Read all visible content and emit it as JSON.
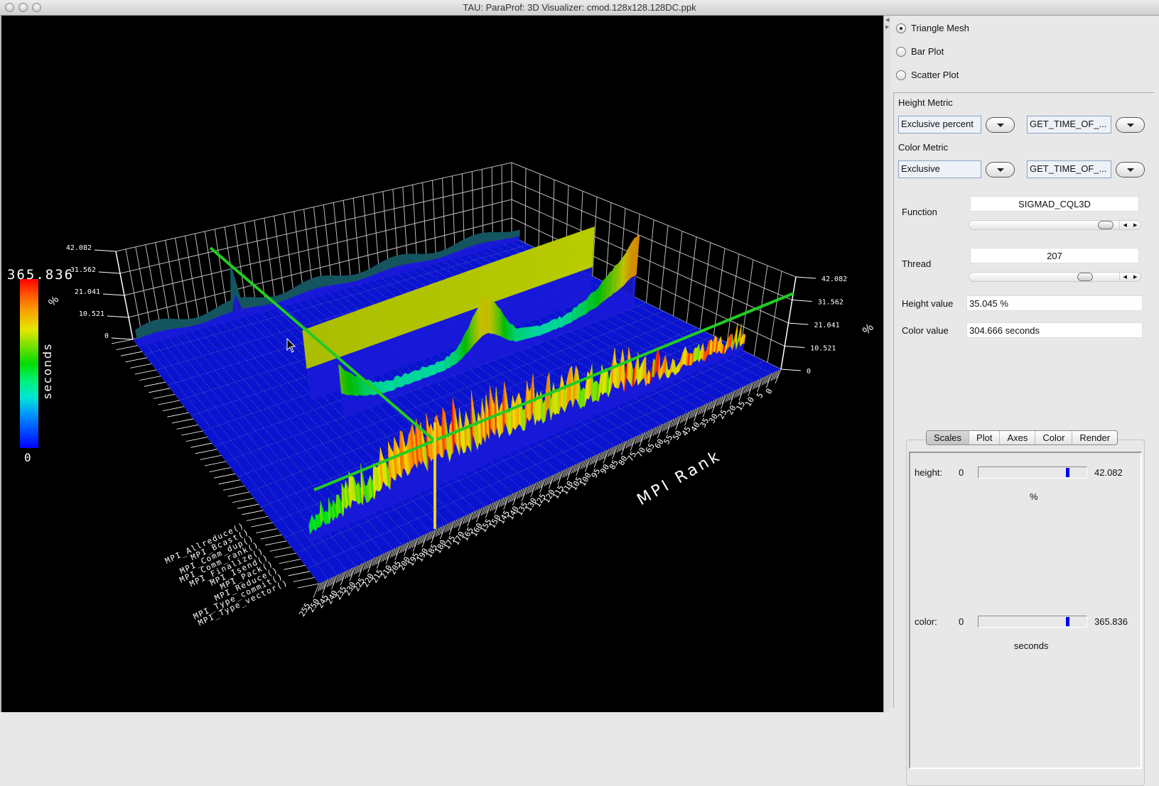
{
  "window": {
    "title": "TAU: ParaProf: 3D Visualizer: cmod.128x128.128DC.ppk"
  },
  "plot_type": {
    "options": [
      {
        "label": "Triangle Mesh",
        "selected": true
      },
      {
        "label": "Bar Plot",
        "selected": false
      },
      {
        "label": "Scatter Plot",
        "selected": false
      }
    ]
  },
  "height_metric": {
    "label": "Height Metric",
    "metric": "Exclusive percent",
    "counter": "GET_TIME_OF_..."
  },
  "color_metric": {
    "label": "Color Metric",
    "metric": "Exclusive",
    "counter": "GET_TIME_OF_..."
  },
  "function": {
    "label": "Function",
    "value": "SIGMAD_CQL3D",
    "slider_fraction": 0.95
  },
  "thread": {
    "label": "Thread",
    "value": "207",
    "slider_fraction": 0.8
  },
  "height_value": {
    "label": "Height value",
    "value": "35.045 %"
  },
  "color_value": {
    "label": "Color value",
    "value": "304.666 seconds"
  },
  "tabs": [
    {
      "label": "Scales",
      "active": true
    },
    {
      "label": "Plot",
      "active": false
    },
    {
      "label": "Axes",
      "active": false
    },
    {
      "label": "Color",
      "active": false
    },
    {
      "label": "Render",
      "active": false
    }
  ],
  "scales": {
    "height": {
      "label": "height:",
      "min": "0",
      "max": "42.082",
      "unit": "%",
      "fraction": 0.83
    },
    "color": {
      "label": "color:",
      "min": "0",
      "max": "365.836",
      "unit": "seconds",
      "fraction": 0.83
    }
  },
  "visualization": {
    "colorbar": {
      "max": "365.836",
      "min": "0",
      "unit": "seconds"
    },
    "height_axis": {
      "ticks": [
        "0",
        "10.521",
        "21.041",
        "31.562",
        "42.082"
      ],
      "unit": "%"
    },
    "rank_axis": {
      "label": "MPI Rank",
      "min": 0,
      "max": 255,
      "tick_step": 5
    },
    "function_labels": [
      "MPI_Allreduce()",
      "MPI_Bcast()",
      "MPI_Comm_dup()",
      "MPI_Comm_rank()",
      "MPI_Finalize()",
      "MPI_Isend()",
      "MPI_Pack()",
      "MPI_Reduce()",
      "MPI_Type_commit()",
      "MPI_Type_vector()"
    ],
    "colors": {
      "background": "#000000",
      "floor": "#0a14d0",
      "grid": "#dddddd",
      "selection_line": "#22cc22",
      "selection_bar": "#e6d21e"
    }
  }
}
